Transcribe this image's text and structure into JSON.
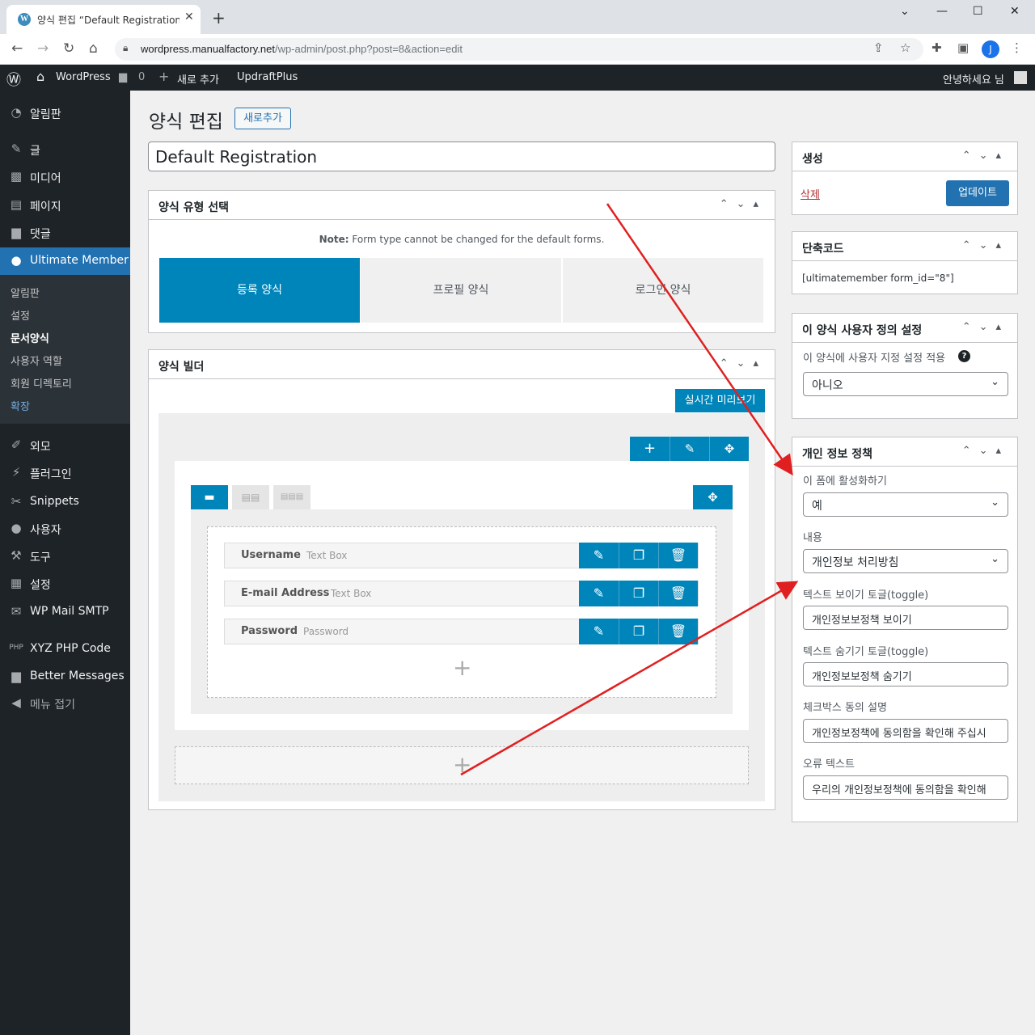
{
  "browser": {
    "tab_title": "양식 편집 “Default Registration”",
    "url_host": "wordpress.manualfactory.net",
    "url_path": "/wp-admin/post.php?post=8&action=edit",
    "profile_initial": "J"
  },
  "adminbar": {
    "site": "WordPress",
    "comments": "0",
    "new": "새로 추가",
    "plugin": "UpdraftPlus",
    "greeting": "안녕하세요 님"
  },
  "sidebar": {
    "items": [
      {
        "label": "알림판",
        "icon": "dashboard-icon"
      },
      {
        "label": "글",
        "icon": "pin-icon"
      },
      {
        "label": "미디어",
        "icon": "media-icon"
      },
      {
        "label": "페이지",
        "icon": "page-icon"
      },
      {
        "label": "댓글",
        "icon": "comment-icon"
      },
      {
        "label": "Ultimate Member",
        "icon": "user-icon"
      }
    ],
    "submenu": [
      "알림판",
      "설정",
      "문서양식",
      "사용자 역할",
      "회원 디렉토리",
      "확장"
    ],
    "items2": [
      {
        "label": "외모",
        "icon": "brush-icon"
      },
      {
        "label": "플러그인",
        "icon": "plugin-icon"
      },
      {
        "label": "Snippets",
        "icon": "scissors-icon"
      },
      {
        "label": "사용자",
        "icon": "users-icon"
      },
      {
        "label": "도구",
        "icon": "wrench-icon"
      },
      {
        "label": "설정",
        "icon": "settings-icon"
      },
      {
        "label": "WP Mail SMTP",
        "icon": "mail-icon"
      },
      {
        "label": "XYZ PHP Code",
        "icon": "php-icon"
      },
      {
        "label": "Better Messages",
        "icon": "messages-icon"
      },
      {
        "label": "메뉴 접기",
        "icon": "collapse-icon"
      }
    ]
  },
  "page": {
    "title": "양식 편집",
    "add_new": "새로추가",
    "form_title": "Default Registration"
  },
  "formtype": {
    "heading": "양식 유형 선택",
    "note_bold": "Note:",
    "note": " Form type cannot be changed for the default forms.",
    "tabs": [
      "등록 양식",
      "프로필 양식",
      "로그인 양식"
    ]
  },
  "builder": {
    "heading": "양식 빌더",
    "preview": "실시간 미리보기",
    "fields": [
      {
        "name": "Username",
        "type": "Text Box"
      },
      {
        "name": "E-mail Address",
        "type": "Text Box"
      },
      {
        "name": "Password",
        "type": "Password"
      }
    ]
  },
  "publish": {
    "heading": "생성",
    "delete": "삭제",
    "update": "업데이트"
  },
  "shortcode": {
    "heading": "단축코드",
    "code": "[ultimatemember form_id=\"8\"]"
  },
  "custom": {
    "heading": "이 양식 사용자 정의 설정",
    "label": "이 양식에 사용자 지정 설정 적용",
    "value": "아니오"
  },
  "privacy": {
    "heading": "개인 정보 정책",
    "activate_label": "이 폼에 활성화하기",
    "activate_value": "예",
    "content_label": "내용",
    "content_value": "개인정보 처리방침",
    "show_label": "텍스트 보이기 토글(toggle)",
    "show_value": "개인정보보정책 보이기",
    "hide_label": "텍스트 숨기기 토글(toggle)",
    "hide_value": "개인정보보정책 숨기기",
    "checkbox_label": "체크박스 동의 설명",
    "checkbox_value": "개인정보정책에 동의함을 확인해 주십시",
    "error_label": "오류 텍스트",
    "error_value": "우리의 개인정보정책에 동의함을 확인해"
  },
  "colors": {
    "accent": "#0085ba",
    "admin_bar": "#1d2327",
    "active_menu": "#2271b1",
    "arrow": "#e02020"
  }
}
